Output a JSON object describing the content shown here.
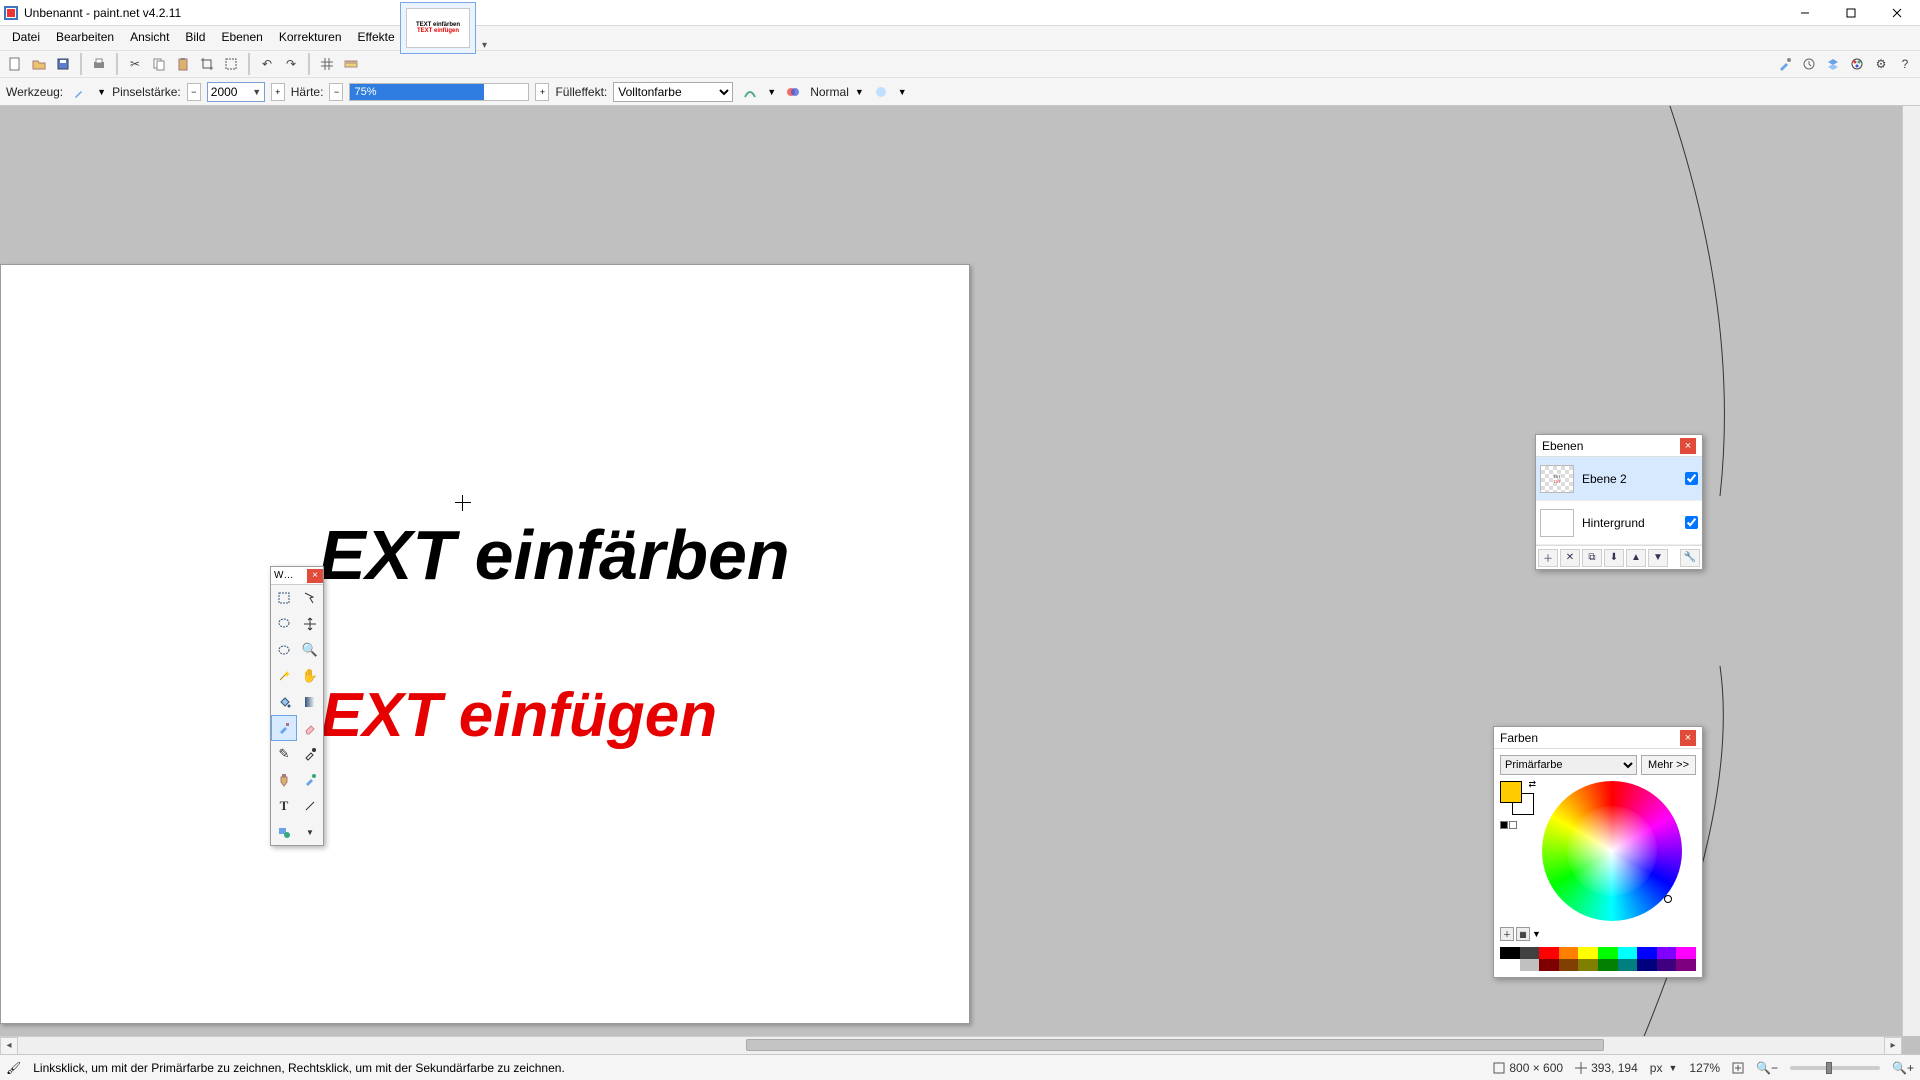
{
  "window": {
    "title": "Unbenannt - paint.net v4.2.11"
  },
  "menu": {
    "items": [
      "Datei",
      "Bearbeiten",
      "Ansicht",
      "Bild",
      "Ebenen",
      "Korrekturen",
      "Effekte"
    ]
  },
  "tool_options": {
    "tool_label": "Werkzeug:",
    "brush_label": "Pinselstärke:",
    "brush_value": "2000",
    "hardness_label": "Härte:",
    "hardness_value": "75%",
    "fill_label": "Fülleffekt:",
    "fill_value": "Volltonfarbe",
    "blend_label": "Normal"
  },
  "canvas": {
    "text_top": "EXT einfärben",
    "text_bottom": "EXT einfügen"
  },
  "tools_panel": {
    "title": "W…"
  },
  "layers_panel": {
    "title": "Ebenen",
    "rows": [
      {
        "name": "Ebene 2",
        "visible": true
      },
      {
        "name": "Hintergrund",
        "visible": true
      }
    ]
  },
  "colors_panel": {
    "title": "Farben",
    "mode": "Primärfarbe",
    "more": "Mehr >>",
    "primary_hex": "#ffcc00",
    "secondary_hex": "#ffffff"
  },
  "status": {
    "hint": "Linksklick, um mit der Primärfarbe zu zeichnen, Rechtsklick, um mit der Sekundärfarbe zu zeichnen.",
    "doc_size": "800 × 600",
    "cursor_pos": "393, 194",
    "unit": "px",
    "zoom": "127%"
  }
}
